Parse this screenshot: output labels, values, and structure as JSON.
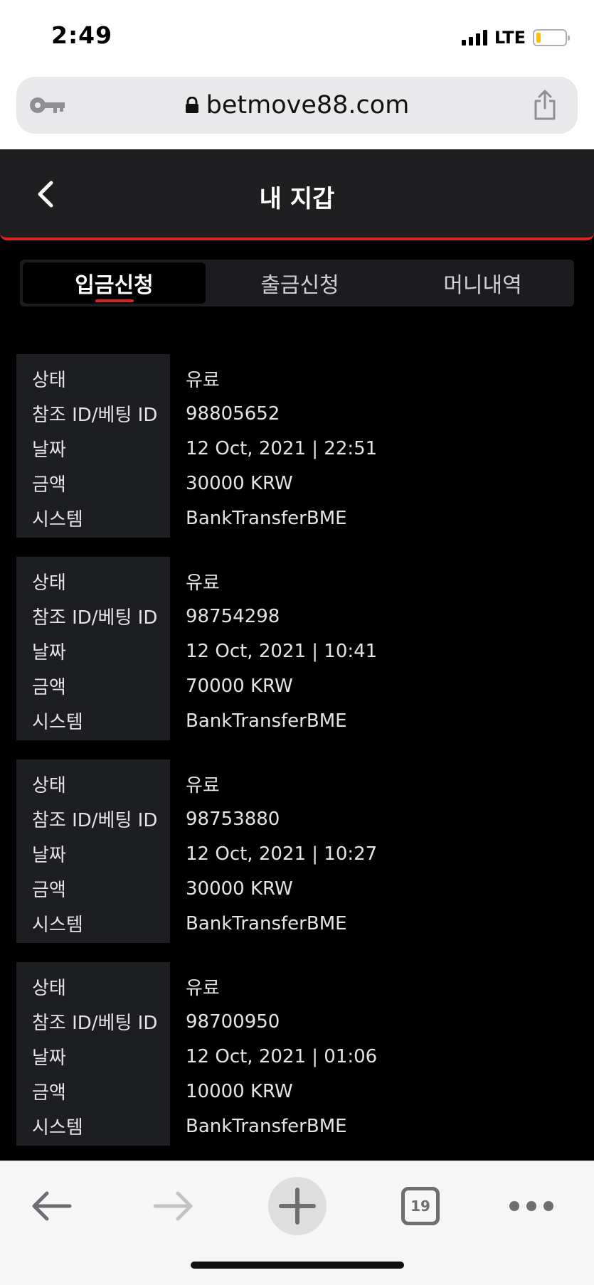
{
  "status_bar": {
    "time": "2:49",
    "network": "LTE"
  },
  "browser": {
    "url": "betmove88.com",
    "tab_count": "19"
  },
  "header": {
    "title": "내 지갑"
  },
  "tabs": [
    {
      "label": "입금신청",
      "active": true
    },
    {
      "label": "출금신청",
      "active": false
    },
    {
      "label": "머니내역",
      "active": false
    }
  ],
  "field_labels": {
    "status": "상태",
    "ref_id": "참조 ID/베팅 ID",
    "date": "날짜",
    "amount": "금액",
    "system": "시스템"
  },
  "records": [
    {
      "status": "유료",
      "ref_id": "98805652",
      "date": "12 Oct, 2021 | 22:51",
      "amount": "30000 KRW",
      "system": "BankTransferBME"
    },
    {
      "status": "유료",
      "ref_id": "98754298",
      "date": "12 Oct, 2021 | 10:41",
      "amount": "70000 KRW",
      "system": "BankTransferBME"
    },
    {
      "status": "유료",
      "ref_id": "98753880",
      "date": "12 Oct, 2021 | 10:27",
      "amount": "30000 KRW",
      "system": "BankTransferBME"
    },
    {
      "status": "유료",
      "ref_id": "98700950",
      "date": "12 Oct, 2021 | 01:06",
      "amount": "10000 KRW",
      "system": "BankTransferBME"
    }
  ],
  "colors": {
    "accent": "#d9261c",
    "label_bg": "#1d1e22",
    "header_bg": "#1f1f22"
  }
}
